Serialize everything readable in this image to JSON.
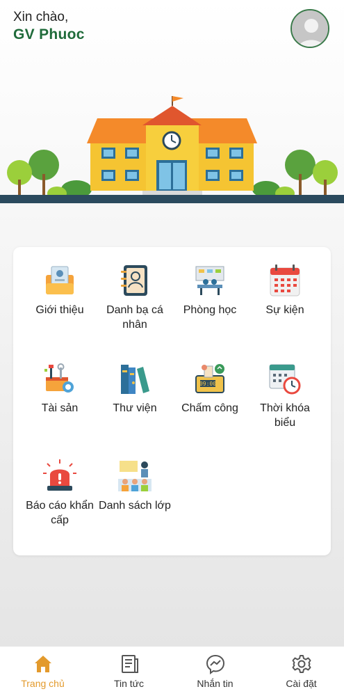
{
  "header": {
    "greeting": "Xin chào,",
    "username": "GV Phuoc"
  },
  "menu": {
    "items": [
      {
        "label": "Giới thiệu",
        "icon": "id-card-folder-icon"
      },
      {
        "label": "Danh bạ cá nhân",
        "icon": "address-book-icon"
      },
      {
        "label": "Phòng học",
        "icon": "classroom-icon"
      },
      {
        "label": "Sự kiện",
        "icon": "calendar-icon"
      },
      {
        "label": "Tài sản",
        "icon": "toolbox-icon"
      },
      {
        "label": "Thư viện",
        "icon": "books-icon"
      },
      {
        "label": "Chấm công",
        "icon": "time-clock-icon"
      },
      {
        "label": "Thời khóa biểu",
        "icon": "schedule-icon"
      },
      {
        "label": "Báo cáo khẩn cấp",
        "icon": "siren-icon"
      },
      {
        "label": "Danh sách lớp",
        "icon": "class-list-icon"
      }
    ]
  },
  "nav": {
    "items": [
      {
        "label": "Trang chủ",
        "icon": "home-icon",
        "active": true
      },
      {
        "label": "Tin tức",
        "icon": "news-icon",
        "active": false
      },
      {
        "label": "Nhắn tin",
        "icon": "messenger-icon",
        "active": false
      },
      {
        "label": "Cài đặt",
        "icon": "gear-icon",
        "active": false
      }
    ]
  },
  "colors": {
    "accent": "#e39a2c",
    "brand_green": "#1f6b3a",
    "ground": "#2b4a5e"
  }
}
